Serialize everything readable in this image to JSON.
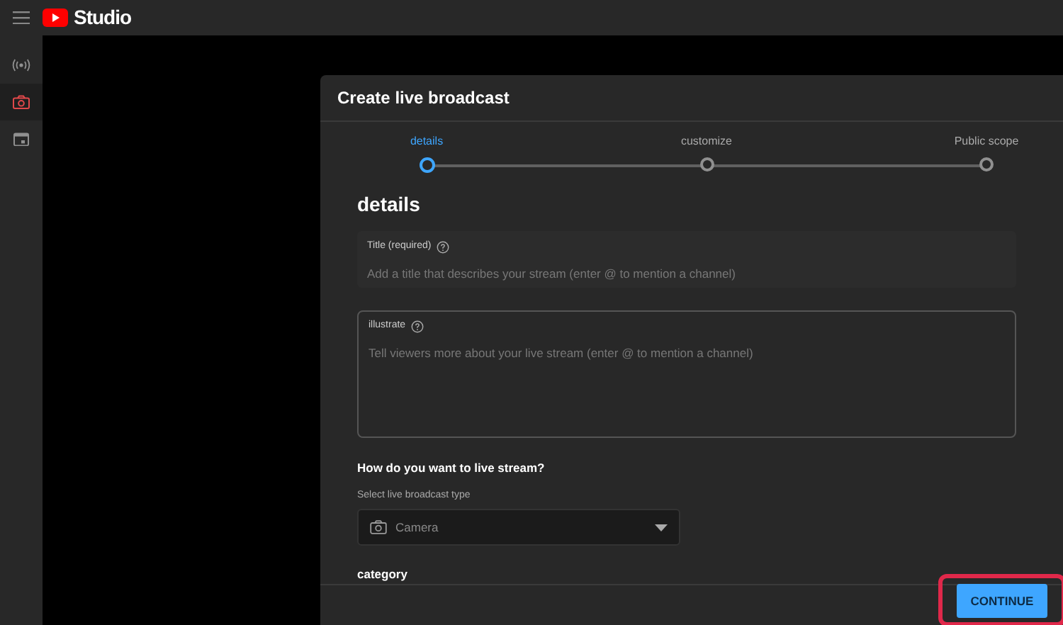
{
  "app": {
    "title": "Studio"
  },
  "sidebar": {
    "items": [
      {
        "kind": "broadcast",
        "selected": false
      },
      {
        "kind": "camera",
        "selected": true
      },
      {
        "kind": "calendar",
        "selected": false
      }
    ]
  },
  "dialog": {
    "title": "Create live broadcast",
    "steps": [
      {
        "label": "details",
        "selected": true
      },
      {
        "label": "customize",
        "selected": false
      },
      {
        "label": "Public scope",
        "selected": false
      }
    ],
    "section_title": "details",
    "title_field": {
      "label": "Title (required)",
      "placeholder": "Add a title that describes your stream (enter @ to mention a channel)"
    },
    "description_field": {
      "label": "illustrate",
      "placeholder": "Tell viewers more about your live stream (enter @ to mention a channel)"
    },
    "stream_question": "How do you want to live stream?",
    "type_label": "Select live broadcast type",
    "type_select": {
      "value": "Camera"
    },
    "category_heading": "category",
    "continue_button": {
      "label": "CONTINUE",
      "highlighted": true
    }
  }
}
